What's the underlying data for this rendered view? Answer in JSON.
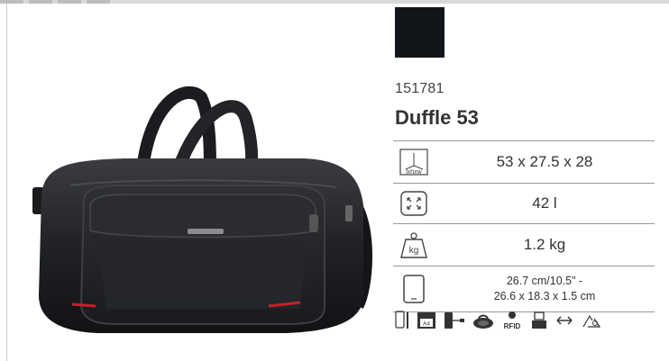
{
  "product": {
    "sku": "151781",
    "title": "Duffle 53",
    "color_swatch": "#12161a"
  },
  "specs": [
    {
      "icon": "dimensions-icon",
      "icon_label": "lxhxw",
      "value": "53 x 27.5 x 28"
    },
    {
      "icon": "volume-icon",
      "value": "42 l"
    },
    {
      "icon": "weight-icon",
      "icon_label": "kg",
      "value": "1.2 kg"
    },
    {
      "icon": "tablet-icon",
      "value_line1": "26.7 cm/10.5\" -",
      "value_line2": "26.6 x 18.3 x 1.5 cm"
    }
  ],
  "features": [
    "phone-pocket-icon",
    "document-pocket-icon",
    "usb-port-icon",
    "lock-icon",
    "rfid-icon",
    "trolley-sleeve-icon",
    "expandable-icon",
    "recycled-icon"
  ],
  "feature_texts": {
    "document": "A4",
    "rfid": "RFID"
  }
}
